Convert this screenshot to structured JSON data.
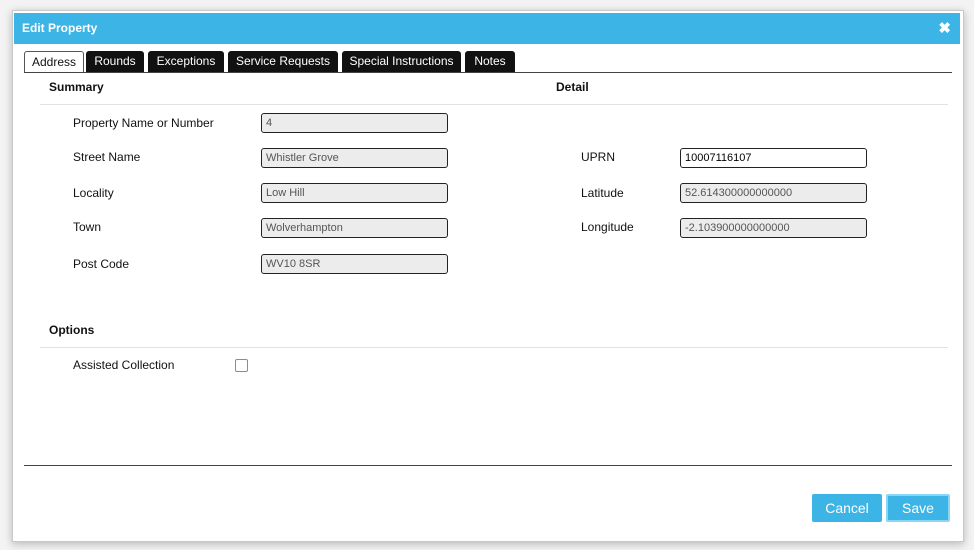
{
  "dialog": {
    "title": "Edit Property",
    "close_glyph": "✖"
  },
  "tabs": [
    {
      "label": "Address",
      "active": true
    },
    {
      "label": "Rounds"
    },
    {
      "label": "Exceptions"
    },
    {
      "label": "Service Requests"
    },
    {
      "label": "Special Instructions"
    },
    {
      "label": "Notes"
    }
  ],
  "summary": {
    "heading": "Summary",
    "fields": [
      {
        "label": "Property Name or Number",
        "value": "4"
      },
      {
        "label": "Street Name",
        "value": "Whistler Grove"
      },
      {
        "label": "Locality",
        "value": "Low Hill"
      },
      {
        "label": "Town",
        "value": "Wolverhampton"
      },
      {
        "label": "Post Code",
        "value": "WV10 8SR"
      }
    ]
  },
  "detail": {
    "heading": "Detail",
    "fields": [
      {
        "label": "UPRN",
        "value": "10007116107"
      },
      {
        "label": "Latitude",
        "value": "52.614300000000000"
      },
      {
        "label": "Longitude",
        "value": "-2.103900000000000"
      }
    ]
  },
  "options": {
    "heading": "Options",
    "assisted_collection": {
      "label": "Assisted Collection",
      "checked": false
    }
  },
  "footer": {
    "cancel_label": "Cancel",
    "save_label": "Save"
  },
  "colors": {
    "accent": "#3cb4e6",
    "tab_bg": "#111111",
    "readonly_field_bg": "#ececec"
  }
}
